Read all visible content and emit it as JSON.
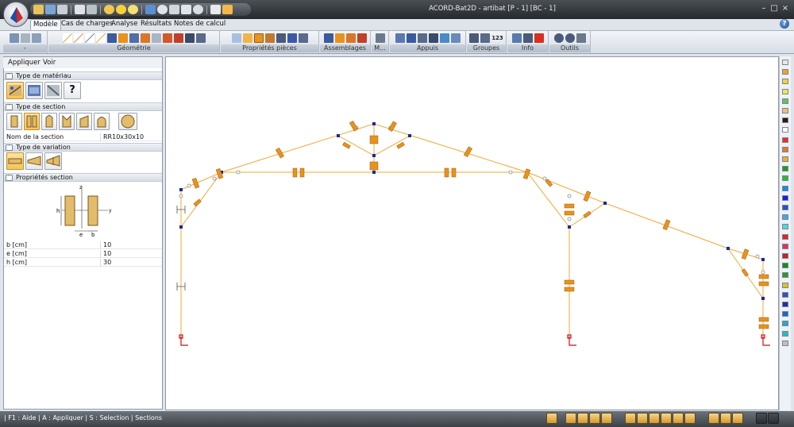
{
  "window": {
    "title": "ACORD-Bat2D - artibat [P - 1] [BC - 1]",
    "controls": [
      "–",
      "□",
      "×"
    ]
  },
  "menu": {
    "tabs": [
      "Modèle",
      "Cas de charges",
      "Analyse",
      "Résultats",
      "Notes de calcul"
    ],
    "active_tab": "Modèle",
    "help": "?"
  },
  "ribbon": {
    "groups": [
      {
        "label": "-"
      },
      {
        "label": "Géométrie"
      },
      {
        "label": "Propriétés pièces"
      },
      {
        "label": "Assemblages"
      },
      {
        "label": "M..."
      },
      {
        "label": "Appuis"
      },
      {
        "label": "Groupes"
      },
      {
        "label": "Info"
      },
      {
        "label": "Outils"
      }
    ],
    "counter_label": "123"
  },
  "panel": {
    "menu": [
      "Appliquer",
      "Voir"
    ],
    "material_section": "Type de matériau",
    "section_type": "Type de section",
    "section_name_label": "Nom de la section",
    "section_name_value": "RR10x30x10",
    "variation_section": "Type de variation",
    "properties_section": "Propriétés section",
    "diagram_labels": {
      "z": "z",
      "y": "y",
      "h": "h",
      "e": "e",
      "b": "b"
    },
    "properties": [
      {
        "label": "b  [cm]",
        "value": "10"
      },
      {
        "label": "e  [cm]",
        "value": "10"
      },
      {
        "label": "h  [cm]",
        "value": "30"
      }
    ]
  },
  "status": {
    "text": "| F1 : Aide | A : Appliquer | S : Selection |    Sections"
  },
  "colors": {
    "frame": "#f0a830",
    "member": "#e8931c",
    "node": "#1a2a9a",
    "support": "#cc1111",
    "accent": "#f7c35a",
    "palette": [
      "#e8e8e8",
      "#f0a030",
      "#f4d040",
      "#e8e858",
      "#5ac85a",
      "#f0c070",
      "#2a1a10",
      "#ffffff",
      "#e83020",
      "#e87828",
      "#f0b020",
      "#1aa01a",
      "#32b832",
      "#1a88e8",
      "#1a1ae8",
      "#1a55c8",
      "#40a8e8",
      "#50d8d8",
      "#e82020",
      "#e83050",
      "#c82020",
      "#1a8a1a",
      "#2a9a2a",
      "#e0c020",
      "#3050c8",
      "#2030a8",
      "#1a68c8",
      "#28a8c8",
      "#20c0c0",
      "#c0c0c0"
    ]
  }
}
